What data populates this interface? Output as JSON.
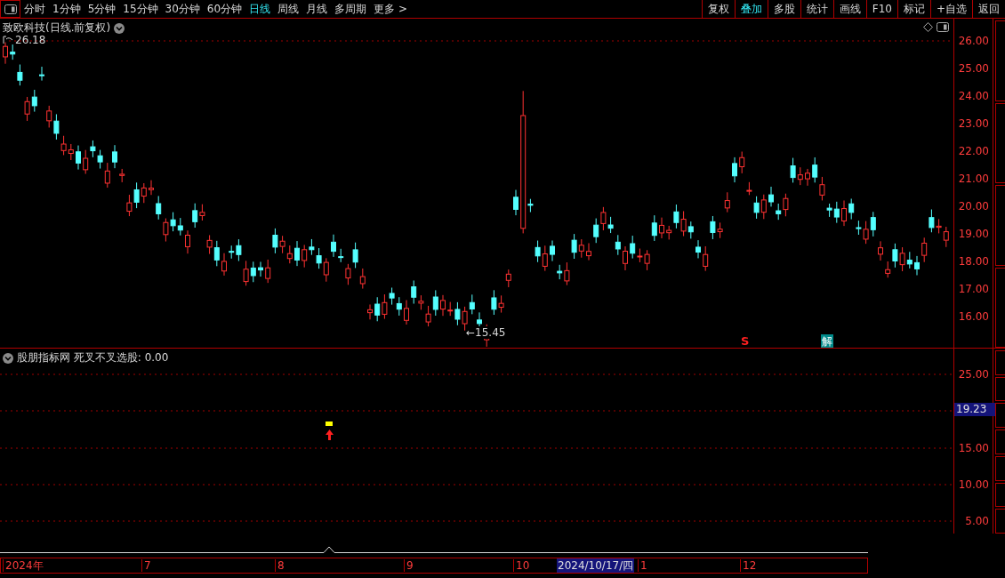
{
  "toolbar": {
    "periods": [
      {
        "label": "分时",
        "selected": false
      },
      {
        "label": "1分钟",
        "selected": false
      },
      {
        "label": "5分钟",
        "selected": false
      },
      {
        "label": "15分钟",
        "selected": false
      },
      {
        "label": "30分钟",
        "selected": false
      },
      {
        "label": "60分钟",
        "selected": false
      },
      {
        "label": "日线",
        "selected": true
      },
      {
        "label": "周线",
        "selected": false
      },
      {
        "label": "月线",
        "selected": false
      },
      {
        "label": "多周期",
        "selected": false
      },
      {
        "label": "更多 >",
        "selected": false
      }
    ],
    "actions": [
      {
        "label": "复权",
        "selected": false
      },
      {
        "label": "叠加",
        "selected": true
      },
      {
        "label": "多股",
        "selected": false
      },
      {
        "label": "统计",
        "selected": false
      },
      {
        "label": "画线",
        "selected": false
      },
      {
        "label": "F10",
        "selected": false
      },
      {
        "label": "标记",
        "selected": false
      },
      {
        "label": "+自选",
        "selected": false
      },
      {
        "label": "返回",
        "selected": false
      }
    ]
  },
  "main_panel": {
    "title": "致欧科技(日线.前复权)",
    "high_label": "26.18",
    "low_label": "←15.45",
    "signals": [
      {
        "kind": "sell",
        "text": "S"
      },
      {
        "kind": "unlock",
        "text": "解"
      }
    ],
    "axis_ticks": [
      "26.00",
      "25.00",
      "24.00",
      "23.00",
      "22.00",
      "21.00",
      "20.00",
      "19.00",
      "18.00",
      "17.00",
      "16.00"
    ]
  },
  "indicator_panel": {
    "title": "股朋指标网 死叉不叉选股: 0.00",
    "axis_ticks": [
      "25.00",
      "15.00",
      "10.00",
      "5.00"
    ],
    "current_value": "19.23"
  },
  "time_axis": {
    "labels": [
      "2024年",
      "7",
      "8",
      "9",
      "10"
    ],
    "cursor_date": "2024/10/17/四",
    "labels_after": [
      "1",
      "12"
    ]
  }
}
